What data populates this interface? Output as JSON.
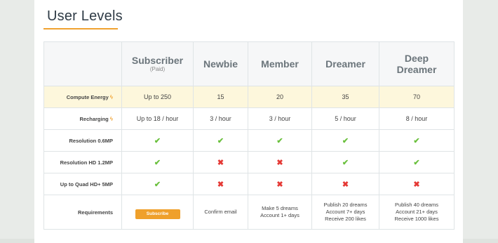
{
  "page": {
    "title": "User Levels",
    "accent": "#f0a230"
  },
  "plans": [
    {
      "name": "Subscriber",
      "sub": "(Paid)"
    },
    {
      "name": "Newbie",
      "sub": ""
    },
    {
      "name": "Member",
      "sub": ""
    },
    {
      "name": "Dreamer",
      "sub": ""
    },
    {
      "name": "Deep Dreamer",
      "sub": ""
    }
  ],
  "rows": {
    "compute": {
      "label": "Compute Energy",
      "icon": "bolt-icon",
      "values": [
        "Up to 250",
        "15",
        "20",
        "35",
        "70"
      ]
    },
    "recharge": {
      "label": "Recharging",
      "icon": "bolt-icon",
      "values": [
        "Up to 18 / hour",
        "3 / hour",
        "3 / hour",
        "5 / hour",
        "8 / hour"
      ]
    },
    "res06": {
      "label": "Resolution 0.6MP",
      "values": [
        "check",
        "check",
        "check",
        "check",
        "check"
      ]
    },
    "res12": {
      "label": "Resolution HD 1.2MP",
      "values": [
        "check",
        "cross",
        "cross",
        "check",
        "check"
      ]
    },
    "res5": {
      "label": "Up to Quad HD+ 5MP",
      "values": [
        "check",
        "cross",
        "cross",
        "cross",
        "cross"
      ]
    },
    "req": {
      "label": "Requirements",
      "button": "Subscribe",
      "newbie": [
        "Confirm email"
      ],
      "member": [
        "Make 5 dreams",
        "Account 1+ days"
      ],
      "dreamer": [
        "Publish 20 dreams",
        "Account 7+ days",
        "Receive 200 likes"
      ],
      "deep": [
        "Publish 40 dreams",
        "Account 21+ days",
        "Receive 1000 likes"
      ]
    }
  },
  "symbols": {
    "check": "✔",
    "cross": "✖",
    "bolt": "ϟ"
  },
  "colors": {
    "check": "#6ac03d",
    "cross": "#e53935",
    "button": "#efa02b",
    "energy_row": "#fdf7dc"
  }
}
